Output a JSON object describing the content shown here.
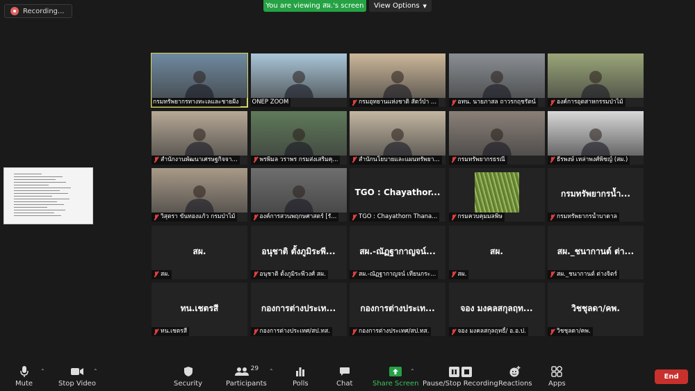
{
  "recording": {
    "label": "Recording..."
  },
  "banner": {
    "text": "You are viewing สผ.'s screen"
  },
  "view_options": {
    "label": "View Options",
    "chevron": "chevron-down-icon"
  },
  "tiles": [
    {
      "name": "กรมทรัพยากรทางทะเลและชายฝั่ง",
      "big": "",
      "type": "video",
      "bg": "#6f8aa0",
      "muted": false,
      "active": true
    },
    {
      "name": "ONEP ZOOM",
      "big": "",
      "type": "video",
      "bg": "#a9c6d8",
      "muted": false,
      "active": false
    },
    {
      "name": "กรมอุทยานแห่งชาติ สัตว์ป่า ...",
      "big": "",
      "type": "video",
      "bg": "#cdb89a",
      "muted": true,
      "active": false
    },
    {
      "name": "อทน. นายภาสล ถาวรกฤชรัตน์",
      "big": "",
      "type": "video",
      "bg": "#8a8f94",
      "muted": true,
      "active": false
    },
    {
      "name": "องค์การอุตสาหกรรมป่าไม้",
      "big": "",
      "type": "video",
      "bg": "#9aa678",
      "muted": true,
      "active": false
    },
    {
      "name": "สำนักงานพัฒนาเศรษฐกิจจา...",
      "big": "",
      "type": "video",
      "bg": "#b7a996",
      "muted": true,
      "active": false
    },
    {
      "name": "พรพิมล วราพร กรมส่งเสริมคุ...",
      "big": "",
      "type": "video",
      "bg": "#5f7a5a",
      "muted": true,
      "active": false
    },
    {
      "name": "สำนักนโยบายและแผนทรัพยา...",
      "big": "",
      "type": "video",
      "bg": "#c4b7a2",
      "muted": true,
      "active": false
    },
    {
      "name": "กรมทรัพยากรธรณี",
      "big": "",
      "type": "video",
      "bg": "#8a8078",
      "muted": true,
      "active": false
    },
    {
      "name": "ธีรพงษ์ เหล่าพงศ์พิชญ์ (สผ.)",
      "big": "",
      "type": "video",
      "bg": "#d8d8d8",
      "muted": true,
      "active": false
    },
    {
      "name": "วิสุตรา ขันทองแก้ว กรมป่าไม้",
      "big": "",
      "type": "video",
      "bg": "#a89a88",
      "muted": true,
      "active": false
    },
    {
      "name": "องค์การสวนพฤกษศาสตร์ [รั...",
      "big": "",
      "type": "video",
      "bg": "#6e6e6e",
      "muted": true,
      "active": false
    },
    {
      "name": "TGO : Chayathorn Thana...",
      "big": "TGO : Chayathor...",
      "type": "name",
      "bg": "#232323",
      "muted": true,
      "active": false
    },
    {
      "name": "กรมควบคุมมลพิษ",
      "big": "",
      "type": "image",
      "bg": "#232323",
      "muted": true,
      "active": false
    },
    {
      "name": "กรมทรัพยากรน้ำบาดาล",
      "big": "กรมทรัพยากรน้ำ...",
      "type": "name",
      "bg": "#232323",
      "muted": true,
      "active": false
    },
    {
      "name": "สผ.",
      "big": "สผ.",
      "type": "name",
      "bg": "#232323",
      "muted": true,
      "active": false
    },
    {
      "name": "อนุชาติ ตั้งภูมิระพีวงศ์ สผ.",
      "big": "อนุชาติ ตั้งภูมิระพี...",
      "type": "name",
      "bg": "#232323",
      "muted": true,
      "active": false
    },
    {
      "name": "สผ.-ณัฏฐากาญจน์ เทียนกระ...",
      "big": "สผ.-ณัฏฐากาญจน์...",
      "type": "name",
      "bg": "#232323",
      "muted": true,
      "active": false
    },
    {
      "name": "สผ.",
      "big": "สผ.",
      "type": "name",
      "bg": "#232323",
      "muted": true,
      "active": false
    },
    {
      "name": "สผ._ชนากานต์ ต่างจิตร์",
      "big": "สผ._ชนากานต์ ต่า...",
      "type": "name",
      "bg": "#232323",
      "muted": true,
      "active": false
    },
    {
      "name": "ทน.เชตรสี",
      "big": "ทน.เชตรสี",
      "type": "name",
      "bg": "#232323",
      "muted": true,
      "active": false
    },
    {
      "name": "กองการต่างประเทศ/สป.ทส.",
      "big": "กองการต่างประเท...",
      "type": "name",
      "bg": "#232323",
      "muted": true,
      "active": false
    },
    {
      "name": "กองการต่างประเทศ/สป.ทส.",
      "big": "กองการต่างประเท...",
      "type": "name",
      "bg": "#232323",
      "muted": true,
      "active": false
    },
    {
      "name": "จอง มงคลสกุลฤทธิ์/ อ.อ.ป.",
      "big": "จอง มงคลสกุลฤท...",
      "type": "name",
      "bg": "#232323",
      "muted": true,
      "active": false
    },
    {
      "name": "วิชชุลดา/คพ.",
      "big": "วิชชุลดา/คพ.",
      "type": "name",
      "bg": "#232323",
      "muted": true,
      "active": false
    }
  ],
  "toolbar": {
    "mute": "Mute",
    "stop_video": "Stop Video",
    "security": "Security",
    "participants": "Participants",
    "participants_count": "29",
    "polls": "Polls",
    "chat": "Chat",
    "share_screen": "Share Screen",
    "pause_recording": "Pause/Stop Recording",
    "reactions": "Reactions",
    "apps": "Apps",
    "end": "End"
  },
  "colors": {
    "accent_green": "#25a244",
    "end_red": "#c8302c",
    "active_outline": "#d8d86a",
    "muted_red": "#e04040"
  }
}
